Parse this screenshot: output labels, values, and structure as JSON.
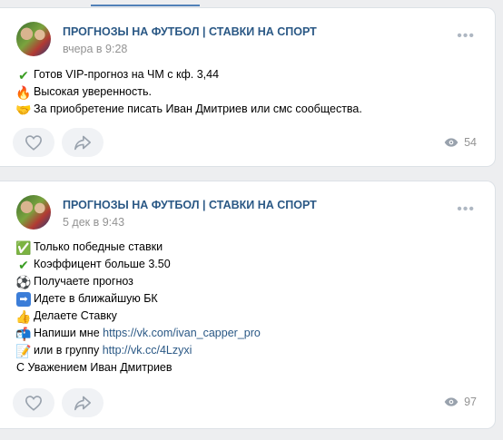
{
  "posts": [
    {
      "author": "ПРОГНОЗЫ НА ФУТБОЛ | СТАВКИ НА СПОРТ",
      "date": "вчера в 9:28",
      "lines": [
        {
          "icon": "✔",
          "icon_name": "check-mark-icon",
          "icon_color": "#3a9d23",
          "text": "Готов VIP-прогноз на ЧМ с кф. 3,44"
        },
        {
          "icon": "🔥",
          "icon_name": "fire-icon",
          "icon_color": "#f26522",
          "text": "Высокая уверенность."
        },
        {
          "icon": "🤝",
          "icon_name": "handshake-icon",
          "icon_color": "#e8a86b",
          "text": "За приобретение писать Иван Дмитриев или смс сообщества."
        }
      ],
      "views": "54"
    },
    {
      "author": "ПРОГНОЗЫ НА ФУТБОЛ | СТАВКИ НА СПОРТ",
      "date": "5 дек в 9:43",
      "lines": [
        {
          "icon": "✅",
          "icon_name": "check-box-icon",
          "icon_color": "#3bb34a",
          "text": "Только победные ставки"
        },
        {
          "icon": "✔",
          "icon_name": "check-mark-icon",
          "icon_color": "#3a9d23",
          "text": "Коэффицент больше 3.50"
        },
        {
          "icon": "⚽",
          "icon_name": "soccer-ball-icon",
          "icon_color": "#222222",
          "text": "Получаете прогноз"
        },
        {
          "icon": "➡",
          "icon_name": "right-arrow-icon",
          "icon_color": "#3b7dd8",
          "text": "Идете в ближайшую БК"
        },
        {
          "icon": "👍",
          "icon_name": "thumbs-up-icon",
          "icon_color": "#f5c26b",
          "text": "Делаете Ставку"
        },
        {
          "icon": "📬",
          "icon_name": "mailbox-icon",
          "icon_color": "#3b7dd8",
          "text": "Напиши мне ",
          "link": "https://vk.com/ivan_capper_pro"
        },
        {
          "icon": "📝",
          "icon_name": "memo-icon",
          "icon_color": "#e8b64a",
          "text": "или в группу ",
          "link": "http://vk.cc/4Lzyxi"
        },
        {
          "icon": "",
          "icon_name": "",
          "icon_color": "",
          "text": "С Уважением Иван Дмитриев"
        }
      ],
      "views": "97"
    }
  ],
  "colors": {
    "link": "#2a5885",
    "muted": "#939393",
    "button_bg": "#f0f2f5",
    "icon_gray": "#99a2ad"
  }
}
